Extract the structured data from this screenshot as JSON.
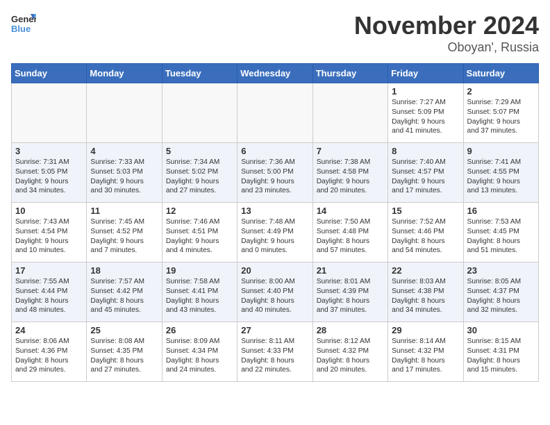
{
  "logo": {
    "general": "General",
    "blue": "Blue"
  },
  "header": {
    "month": "November 2024",
    "location": "Oboyan', Russia"
  },
  "weekdays": [
    "Sunday",
    "Monday",
    "Tuesday",
    "Wednesday",
    "Thursday",
    "Friday",
    "Saturday"
  ],
  "weeks": [
    [
      {
        "day": "",
        "lines": []
      },
      {
        "day": "",
        "lines": []
      },
      {
        "day": "",
        "lines": []
      },
      {
        "day": "",
        "lines": []
      },
      {
        "day": "",
        "lines": []
      },
      {
        "day": "1",
        "lines": [
          "Sunrise: 7:27 AM",
          "Sunset: 5:09 PM",
          "Daylight: 9 hours",
          "and 41 minutes."
        ]
      },
      {
        "day": "2",
        "lines": [
          "Sunrise: 7:29 AM",
          "Sunset: 5:07 PM",
          "Daylight: 9 hours",
          "and 37 minutes."
        ]
      }
    ],
    [
      {
        "day": "3",
        "lines": [
          "Sunrise: 7:31 AM",
          "Sunset: 5:05 PM",
          "Daylight: 9 hours",
          "and 34 minutes."
        ]
      },
      {
        "day": "4",
        "lines": [
          "Sunrise: 7:33 AM",
          "Sunset: 5:03 PM",
          "Daylight: 9 hours",
          "and 30 minutes."
        ]
      },
      {
        "day": "5",
        "lines": [
          "Sunrise: 7:34 AM",
          "Sunset: 5:02 PM",
          "Daylight: 9 hours",
          "and 27 minutes."
        ]
      },
      {
        "day": "6",
        "lines": [
          "Sunrise: 7:36 AM",
          "Sunset: 5:00 PM",
          "Daylight: 9 hours",
          "and 23 minutes."
        ]
      },
      {
        "day": "7",
        "lines": [
          "Sunrise: 7:38 AM",
          "Sunset: 4:58 PM",
          "Daylight: 9 hours",
          "and 20 minutes."
        ]
      },
      {
        "day": "8",
        "lines": [
          "Sunrise: 7:40 AM",
          "Sunset: 4:57 PM",
          "Daylight: 9 hours",
          "and 17 minutes."
        ]
      },
      {
        "day": "9",
        "lines": [
          "Sunrise: 7:41 AM",
          "Sunset: 4:55 PM",
          "Daylight: 9 hours",
          "and 13 minutes."
        ]
      }
    ],
    [
      {
        "day": "10",
        "lines": [
          "Sunrise: 7:43 AM",
          "Sunset: 4:54 PM",
          "Daylight: 9 hours",
          "and 10 minutes."
        ]
      },
      {
        "day": "11",
        "lines": [
          "Sunrise: 7:45 AM",
          "Sunset: 4:52 PM",
          "Daylight: 9 hours",
          "and 7 minutes."
        ]
      },
      {
        "day": "12",
        "lines": [
          "Sunrise: 7:46 AM",
          "Sunset: 4:51 PM",
          "Daylight: 9 hours",
          "and 4 minutes."
        ]
      },
      {
        "day": "13",
        "lines": [
          "Sunrise: 7:48 AM",
          "Sunset: 4:49 PM",
          "Daylight: 9 hours",
          "and 0 minutes."
        ]
      },
      {
        "day": "14",
        "lines": [
          "Sunrise: 7:50 AM",
          "Sunset: 4:48 PM",
          "Daylight: 8 hours",
          "and 57 minutes."
        ]
      },
      {
        "day": "15",
        "lines": [
          "Sunrise: 7:52 AM",
          "Sunset: 4:46 PM",
          "Daylight: 8 hours",
          "and 54 minutes."
        ]
      },
      {
        "day": "16",
        "lines": [
          "Sunrise: 7:53 AM",
          "Sunset: 4:45 PM",
          "Daylight: 8 hours",
          "and 51 minutes."
        ]
      }
    ],
    [
      {
        "day": "17",
        "lines": [
          "Sunrise: 7:55 AM",
          "Sunset: 4:44 PM",
          "Daylight: 8 hours",
          "and 48 minutes."
        ]
      },
      {
        "day": "18",
        "lines": [
          "Sunrise: 7:57 AM",
          "Sunset: 4:42 PM",
          "Daylight: 8 hours",
          "and 45 minutes."
        ]
      },
      {
        "day": "19",
        "lines": [
          "Sunrise: 7:58 AM",
          "Sunset: 4:41 PM",
          "Daylight: 8 hours",
          "and 43 minutes."
        ]
      },
      {
        "day": "20",
        "lines": [
          "Sunrise: 8:00 AM",
          "Sunset: 4:40 PM",
          "Daylight: 8 hours",
          "and 40 minutes."
        ]
      },
      {
        "day": "21",
        "lines": [
          "Sunrise: 8:01 AM",
          "Sunset: 4:39 PM",
          "Daylight: 8 hours",
          "and 37 minutes."
        ]
      },
      {
        "day": "22",
        "lines": [
          "Sunrise: 8:03 AM",
          "Sunset: 4:38 PM",
          "Daylight: 8 hours",
          "and 34 minutes."
        ]
      },
      {
        "day": "23",
        "lines": [
          "Sunrise: 8:05 AM",
          "Sunset: 4:37 PM",
          "Daylight: 8 hours",
          "and 32 minutes."
        ]
      }
    ],
    [
      {
        "day": "24",
        "lines": [
          "Sunrise: 8:06 AM",
          "Sunset: 4:36 PM",
          "Daylight: 8 hours",
          "and 29 minutes."
        ]
      },
      {
        "day": "25",
        "lines": [
          "Sunrise: 8:08 AM",
          "Sunset: 4:35 PM",
          "Daylight: 8 hours",
          "and 27 minutes."
        ]
      },
      {
        "day": "26",
        "lines": [
          "Sunrise: 8:09 AM",
          "Sunset: 4:34 PM",
          "Daylight: 8 hours",
          "and 24 minutes."
        ]
      },
      {
        "day": "27",
        "lines": [
          "Sunrise: 8:11 AM",
          "Sunset: 4:33 PM",
          "Daylight: 8 hours",
          "and 22 minutes."
        ]
      },
      {
        "day": "28",
        "lines": [
          "Sunrise: 8:12 AM",
          "Sunset: 4:32 PM",
          "Daylight: 8 hours",
          "and 20 minutes."
        ]
      },
      {
        "day": "29",
        "lines": [
          "Sunrise: 8:14 AM",
          "Sunset: 4:32 PM",
          "Daylight: 8 hours",
          "and 17 minutes."
        ]
      },
      {
        "day": "30",
        "lines": [
          "Sunrise: 8:15 AM",
          "Sunset: 4:31 PM",
          "Daylight: 8 hours",
          "and 15 minutes."
        ]
      }
    ]
  ]
}
